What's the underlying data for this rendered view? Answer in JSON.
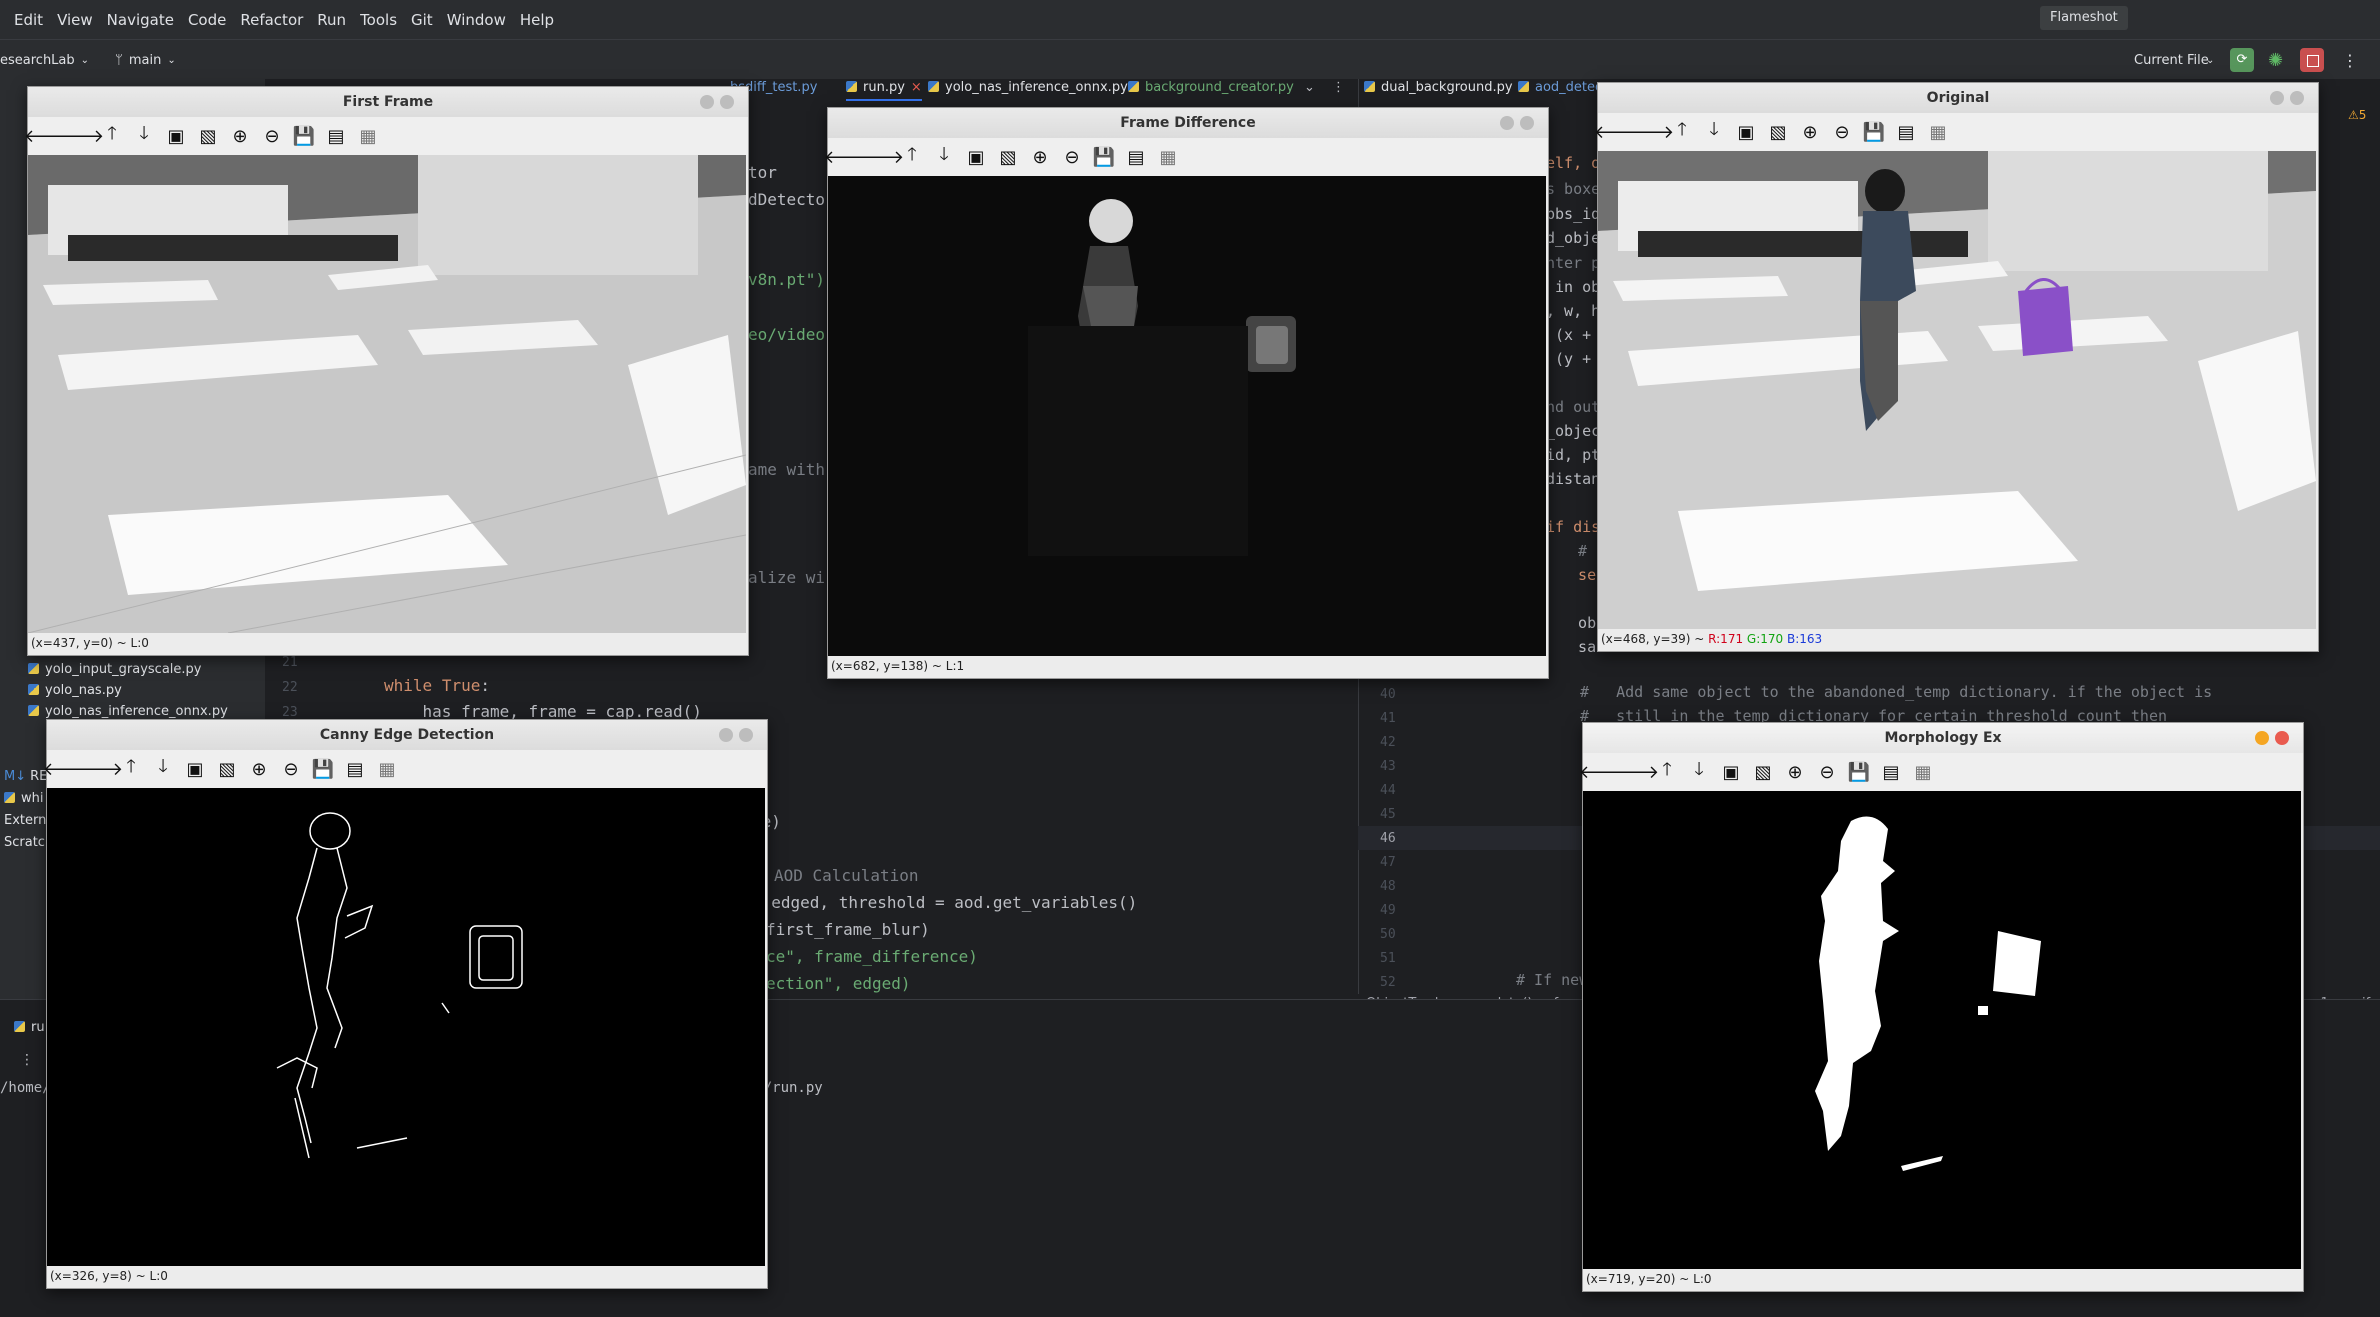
{
  "menu": [
    "Edit",
    "View",
    "Navigate",
    "Code",
    "Refactor",
    "Run",
    "Tools",
    "Git",
    "Window",
    "Help"
  ],
  "flameshot_label": "Flameshot",
  "toolbar": {
    "project": "esearchLab",
    "branch": "main",
    "run_config": "Current File"
  },
  "editor_tabs_left": [
    "bsdiff_test.py",
    "run.py",
    "yolo_nas_inference_onnx.py",
    "background_creator.py"
  ],
  "editor_tabs_right": [
    "dual_background.py",
    "aod_detec"
  ],
  "project_files": [
    "yolo_input_grayscale.py",
    "yolo_nas.py",
    "yolo_nas_inference_onnx.py",
    "REA",
    "whi",
    "Extern",
    "Scratc"
  ],
  "code_left": [
    {
      "ln": "21",
      "text": ""
    },
    {
      "ln": "22",
      "text": "while True:"
    },
    {
      "ln": "23",
      "text": "    has_frame, frame = cap.read()"
    }
  ],
  "code_left_fragments": [
    "tor",
    "dDetector",
    "v8n.pt\")",
    "eo/video",
    "ame with",
    "alize wi",
    "me)",
    "AOD Calculation",
    ", edged, threshold = aod.get_variables()",
    "first_frame_blur)",
    "ce\", frame_difference)",
    "ection\", edged)"
  ],
  "code_right_lines": [
    {
      "ln": "40",
      "text": "#   Add same object to the abandoned_temp dictionary. if the object is"
    },
    {
      "ln": "41",
      "text": "#   still in the temp dictionary for certain threshold count then"
    },
    {
      "ln": "42",
      "text": ""
    },
    {
      "ln": "43",
      "text": ""
    },
    {
      "ln": "44",
      "text": ""
    },
    {
      "ln": "45",
      "text": ""
    },
    {
      "ln": "46",
      "text": ""
    },
    {
      "ln": "47",
      "text": ""
    },
    {
      "ln": "48",
      "text": ""
    },
    {
      "ln": "49",
      "text": ""
    },
    {
      "ln": "50",
      "text": ""
    },
    {
      "ln": "51",
      "text": ""
    },
    {
      "ln": "52",
      "text": "# If new"
    }
  ],
  "code_right_fragments": [
    "elf, o",
    "s boxe",
    "bbs_id",
    "d_obje",
    "nter p",
    " in ob",
    ", w, h",
    " (x +",
    " (y +",
    "nd out",
    "_object",
    "id, pt",
    "distan",
    "if dis",
    "  #",
    "  se",
    "  ob",
    "  sa"
  ],
  "breadcrumb": [
    "ObjectTracker",
    "update()",
    "for r",
    "nce < 1",
    "if"
  ],
  "terminal": {
    "tab": "ru",
    "path_left": "/home/",
    "path_right": "/aod/run.py"
  },
  "warning_count": "5",
  "windows": {
    "first_frame": {
      "title": "First Frame",
      "status": "(x=437, y=0) ~ L:0"
    },
    "frame_difference": {
      "title": "Frame Difference",
      "status": "(x=682, y=138) ~ L:1"
    },
    "original": {
      "title": "Original",
      "status_prefix": "(x=468, y=39) ~ ",
      "r": "R:171",
      "g": "G:170",
      "b": "B:163"
    },
    "canny": {
      "title": "Canny Edge Detection",
      "status": "(x=326, y=8) ~ L:0"
    },
    "morphology": {
      "title": "Morphology Ex",
      "status": "(x=719, y=20) ~ L:0"
    }
  },
  "colors": {
    "ide_bg": "#1e1f22",
    "panel_bg": "#2b2d30",
    "accent_blue": "#3574f0",
    "close_red": "#e95b4f",
    "min_yellow": "#f5a623"
  }
}
